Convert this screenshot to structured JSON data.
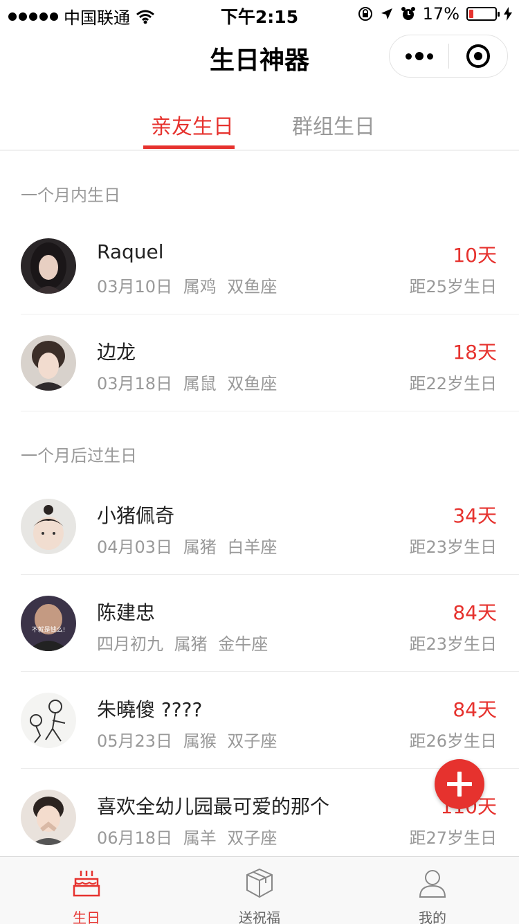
{
  "status_bar": {
    "carrier": "中国联通",
    "time": "下午2:15",
    "battery": "17%",
    "battery_level": 0.17
  },
  "nav": {
    "title": "生日神器"
  },
  "tabs": [
    {
      "label": "亲友生日",
      "active": true
    },
    {
      "label": "群组生日",
      "active": false
    }
  ],
  "sections": [
    {
      "title": "一个月内生日",
      "items": [
        {
          "name": "Raquel",
          "date": "03月10日",
          "zodiac": "属鸡",
          "sign": "双鱼座",
          "days": "10天",
          "age_text": "距25岁生日"
        },
        {
          "name": "边龙",
          "date": "03月18日",
          "zodiac": "属鼠",
          "sign": "双鱼座",
          "days": "18天",
          "age_text": "距22岁生日"
        }
      ]
    },
    {
      "title": "一个月后过生日",
      "items": [
        {
          "name": "小猪佩奇",
          "date": "04月03日",
          "zodiac": "属猪",
          "sign": "白羊座",
          "days": "34天",
          "age_text": "距23岁生日"
        },
        {
          "name": "陈建忠",
          "date": "四月初九",
          "zodiac": "属猪",
          "sign": "金牛座",
          "days": "84天",
          "age_text": "距23岁生日"
        },
        {
          "name": "朱曉傻 ????",
          "date": "05月23日",
          "zodiac": "属猴",
          "sign": "双子座",
          "days": "84天",
          "age_text": "距26岁生日"
        },
        {
          "name": "喜欢全幼儿园最可爱的那个",
          "date": "06月18日",
          "zodiac": "属羊",
          "sign": "双子座",
          "days": "110天",
          "age_text": "距27岁生日"
        }
      ]
    }
  ],
  "avatar_overlay_text": "不就是钱么!",
  "tabbar": [
    {
      "label": "生日",
      "icon": "cake-icon",
      "active": true
    },
    {
      "label": "送祝福",
      "icon": "gift-box-icon",
      "active": false
    },
    {
      "label": "我的",
      "icon": "person-icon",
      "active": false
    }
  ],
  "colors": {
    "accent": "#e6322e",
    "muted": "#999999"
  }
}
